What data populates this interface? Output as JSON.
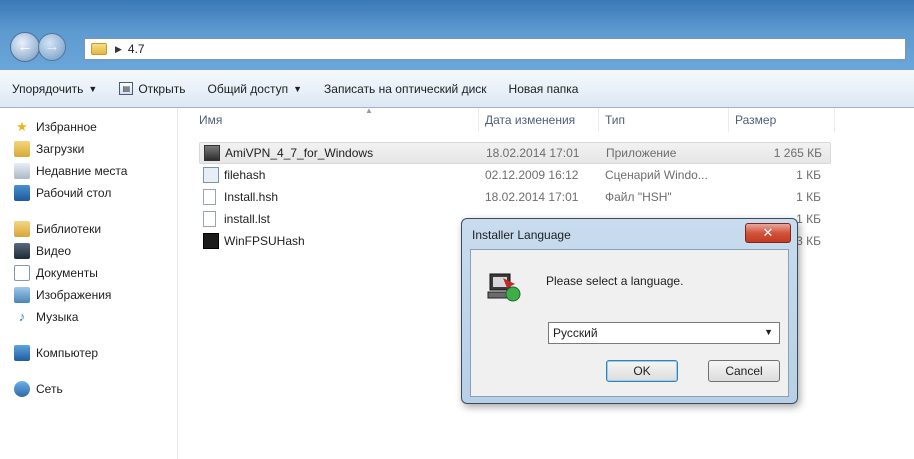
{
  "window": {
    "breadcrumb": "4.7"
  },
  "toolbar": {
    "organize": "Упорядочить",
    "open": "Открыть",
    "share": "Общий доступ",
    "burn": "Записать на оптический диск",
    "new_folder": "Новая папка"
  },
  "nav": {
    "favorites": {
      "title": "Избранное",
      "items": [
        "Загрузки",
        "Недавние места",
        "Рабочий стол"
      ]
    },
    "libraries": {
      "title": "Библиотеки",
      "items": [
        "Видео",
        "Документы",
        "Изображения",
        "Музыка"
      ]
    },
    "computer": "Компьютер",
    "network": "Сеть"
  },
  "list": {
    "columns": [
      "Имя",
      "Дата изменения",
      "Тип",
      "Размер"
    ],
    "rows": [
      {
        "name": "AmiVPN_4_7_for_Windows",
        "date": "18.02.2014 17:01",
        "type": "Приложение",
        "size": "1 265 КБ",
        "icon": "app-icon"
      },
      {
        "name": "filehash",
        "date": "02.12.2009 16:12",
        "type": "Сценарий Windo...",
        "size": "1 КБ",
        "icon": "script-icon"
      },
      {
        "name": "Install.hsh",
        "date": "18.02.2014 17:01",
        "type": "Файл \"HSH\"",
        "size": "1 КБ",
        "icon": "file-icon"
      },
      {
        "name": "install.lst",
        "date": "",
        "type": "",
        "size": "1 КБ",
        "icon": "file-icon"
      },
      {
        "name": "WinFPSUHash",
        "date": "",
        "type": "",
        "size": "3 КБ",
        "icon": "hash-app-icon"
      }
    ]
  },
  "dialog": {
    "title": "Installer Language",
    "message": "Please select a language.",
    "selected_language": "Русский",
    "ok": "OK",
    "cancel": "Cancel"
  }
}
